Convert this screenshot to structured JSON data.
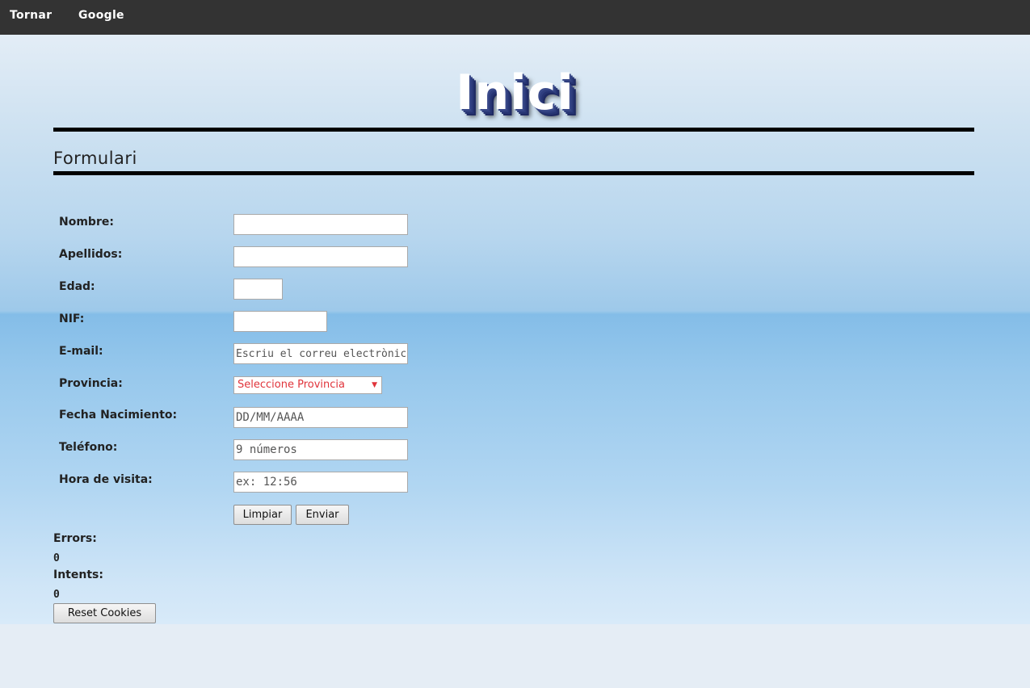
{
  "nav": {
    "tornar": "Tornar",
    "google": "Google"
  },
  "page": {
    "title": "Inici",
    "section_title": "Formulari"
  },
  "form": {
    "nombre": {
      "label": "Nombre:",
      "value": "",
      "placeholder": ""
    },
    "apellidos": {
      "label": "Apellidos:",
      "value": "",
      "placeholder": ""
    },
    "edad": {
      "label": "Edad:",
      "value": "",
      "placeholder": ""
    },
    "nif": {
      "label": "NIF:",
      "value": "",
      "placeholder": ""
    },
    "email": {
      "label": "E-mail:",
      "value": "",
      "placeholder": "Escriu el correu electrònic"
    },
    "provincia": {
      "label": "Provincia:",
      "selected": "Seleccione Provincia"
    },
    "fecha": {
      "label": "Fecha Nacimiento:",
      "value": "",
      "placeholder": "DD/MM/AAAA"
    },
    "telefono": {
      "label": "Teléfono:",
      "value": "",
      "placeholder": "9 números"
    },
    "hora": {
      "label": "Hora de visita:",
      "value": "",
      "placeholder": "ex: 12:56"
    }
  },
  "buttons": {
    "limpiar": "Limpiar",
    "enviar": "Enviar",
    "reset_cookies": "Reset Cookies"
  },
  "stats": {
    "errors_label": "Errors:",
    "errors_value": "0",
    "intents_label": "Intents:",
    "intents_value": "0"
  },
  "colors": {
    "topbar": "#333333",
    "select_text": "#e0343b",
    "title_shadow": "#263472"
  },
  "icons": {
    "select_caret": "caret-down-icon"
  }
}
